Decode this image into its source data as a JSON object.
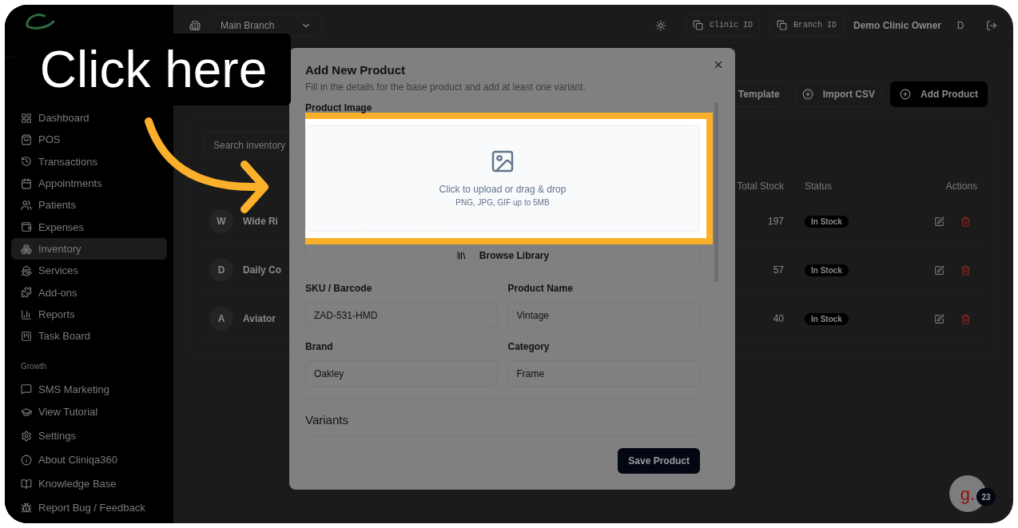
{
  "callout": {
    "text": "Click here"
  },
  "sidebar": {
    "items": [
      {
        "label": "Dashboard",
        "selected": false
      },
      {
        "label": "POS",
        "selected": false
      },
      {
        "label": "Transactions",
        "selected": false
      },
      {
        "label": "Appointments",
        "selected": false
      },
      {
        "label": "Patients",
        "selected": false
      },
      {
        "label": "Expenses",
        "selected": false
      },
      {
        "label": "Inventory",
        "selected": true
      },
      {
        "label": "Services",
        "selected": false
      },
      {
        "label": "Add-ons",
        "selected": false
      },
      {
        "label": "Reports",
        "selected": false
      },
      {
        "label": "Task Board",
        "selected": false
      }
    ],
    "section_label": "Growth",
    "section_items": [
      {
        "label": "SMS Marketing",
        "selected": false
      }
    ],
    "footer_items": [
      {
        "label": "View Tutorial"
      },
      {
        "label": "Settings"
      },
      {
        "label": "About Cliniqa360"
      },
      {
        "label": "Knowledge Base"
      },
      {
        "label": "Report Bug / Feedback"
      }
    ]
  },
  "header": {
    "branch": "Main Branch",
    "id_buttons": [
      "Clinic ID",
      "Branch ID"
    ],
    "user": "Demo Clinic Owner",
    "avatar": "D"
  },
  "toolbar": [
    {
      "label": "Template",
      "kind": "outline"
    },
    {
      "label": "Import CSV",
      "kind": "ghost"
    },
    {
      "label": "Add Product",
      "kind": "primary"
    }
  ],
  "search": {
    "placeholder": "Search inventory"
  },
  "table": {
    "columns": [
      "Total Stock",
      "Status",
      "Actions"
    ],
    "rows": [
      {
        "initial": "W",
        "name": "Wide Ri",
        "stock": "197",
        "status": "In Stock"
      },
      {
        "initial": "D",
        "name": "Daily Co",
        "stock": "57",
        "status": "In Stock"
      },
      {
        "initial": "A",
        "name": "Aviator",
        "stock": "40",
        "status": "In Stock"
      }
    ]
  },
  "modal": {
    "title": "Add New Product",
    "subtitle": "Fill in the details for the base product and add at least one variant.",
    "image_label": "Product Image",
    "upload": {
      "text": "Click to upload or drag & drop",
      "hint": "PNG, JPG, GIF up to 5MB"
    },
    "browse": "Browse Library",
    "fields": [
      {
        "label": "SKU / Barcode",
        "value": "ZAD-531-HMD"
      },
      {
        "label": "Product Name",
        "value": "Vintage"
      },
      {
        "label": "Brand",
        "value": "Oakley"
      },
      {
        "label": "Category",
        "value": "Frame"
      }
    ],
    "section": "Variants",
    "save": "Save Product"
  },
  "widget": {
    "letter": "g.",
    "badge": "23"
  }
}
